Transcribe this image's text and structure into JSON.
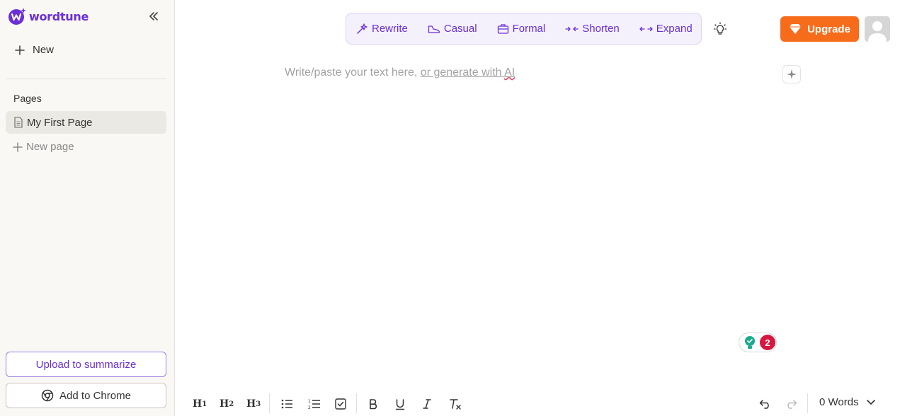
{
  "brand": {
    "name": "wordtune",
    "accent": "#6b2fd6"
  },
  "sidebar": {
    "new_label": "New",
    "pages_heading": "Pages",
    "pages": [
      {
        "label": "My First Page",
        "icon": "document-icon",
        "selected": true
      }
    ],
    "new_page_label": "New page",
    "upload_label": "Upload to summarize",
    "chrome_label": "Add to Chrome"
  },
  "toolbar": {
    "rewrite": "Rewrite",
    "casual": "Casual",
    "formal": "Formal",
    "shorten": "Shorten",
    "expand": "Expand"
  },
  "header": {
    "upgrade_label": "Upgrade",
    "upgrade_color": "#f76c1b"
  },
  "editor": {
    "placeholder_prefix": "Write/paste your text here, ",
    "placeholder_link": "or generate with ",
    "placeholder_ai": "AI"
  },
  "grammar": {
    "count": "2"
  },
  "format_bar": {
    "h1": "H",
    "h1_sub": "1",
    "h2": "H",
    "h2_sub": "2",
    "h3": "H",
    "h3_sub": "3",
    "words_label": "0 Words"
  }
}
